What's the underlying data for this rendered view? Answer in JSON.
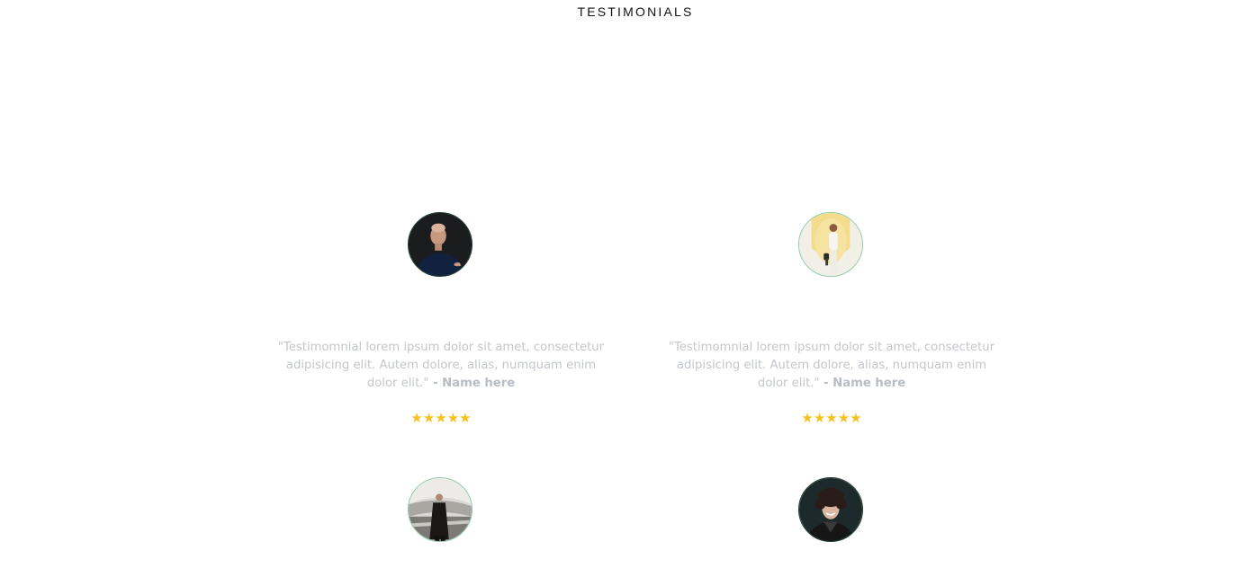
{
  "section": {
    "title": "TESTIMONIALS"
  },
  "testimonials": [
    {
      "avatar_icon": "person-bald-dark-shirt-photo",
      "quote": "\"Testimomnial lorem ipsum dolor sit amet, consectetur adipisicing elit. Autem dolore, alias, numquam enim dolor elit.\"",
      "separator": " - ",
      "author": "Name here",
      "stars": "★★★★★",
      "rating": 5
    },
    {
      "avatar_icon": "person-standing-yellow-bg-photo",
      "quote": "\"Testimomnial lorem ipsum dolor sit amet, consectetur adipisicing elit. Autem dolore, alias, numquam enim dolor elit.\"",
      "separator": " - ",
      "author": "Name here",
      "stars": "★★★★★",
      "rating": 5
    },
    {
      "avatar_icon": "person-dark-coat-building-photo"
    },
    {
      "avatar_icon": "person-curly-hair-dark-bg-photo"
    }
  ],
  "colors": {
    "star": "#f4c21f",
    "quote_text": "#c3c6cc",
    "avatar_border": "#8fc9a8"
  }
}
